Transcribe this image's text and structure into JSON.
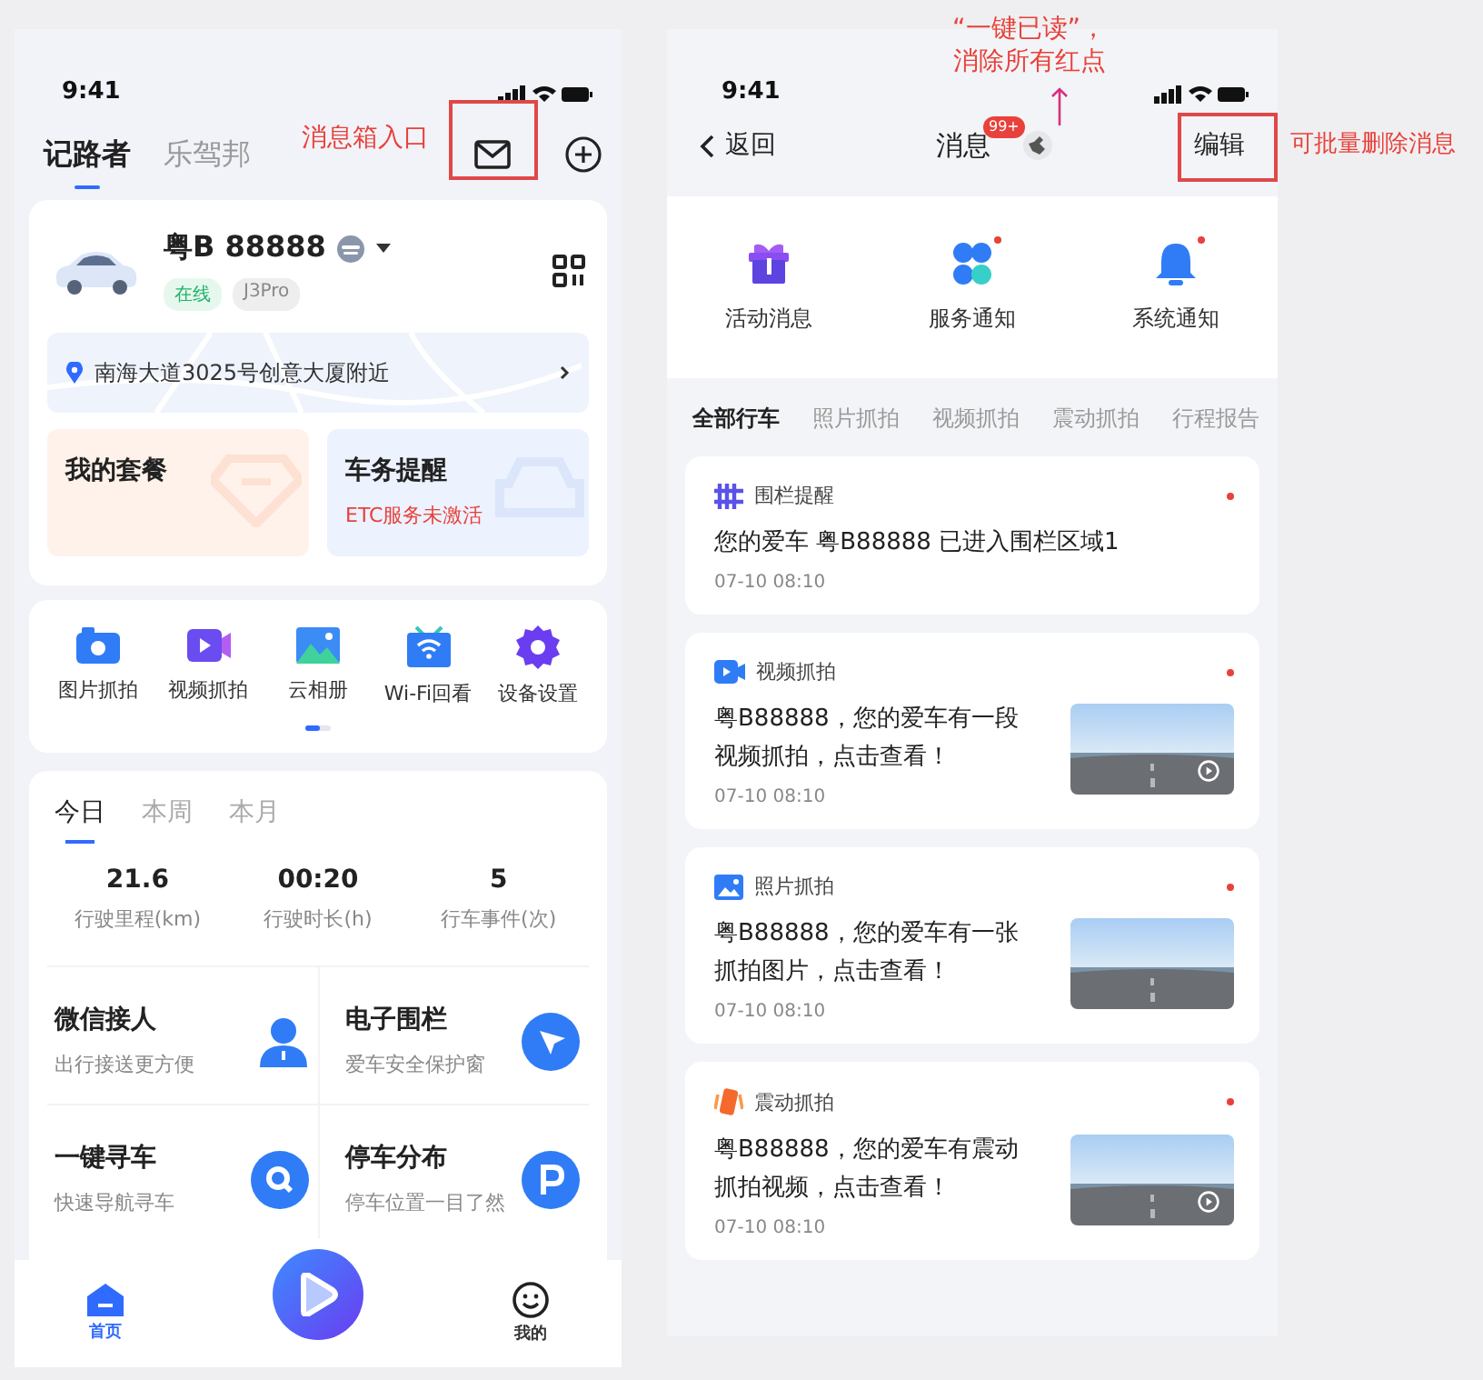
{
  "left_phone": {
    "status_time": "9:41",
    "header_tabs": [
      {
        "label": "记路者",
        "selected": true
      },
      {
        "label": "乐驾邦",
        "selected": false
      }
    ],
    "vehicle": {
      "plate": "粤B 88888",
      "tags": [
        {
          "label": "在线",
          "kind": "status"
        },
        {
          "label": "J3Pro",
          "kind": "model"
        }
      ],
      "location": "南海大道3025号创意大厦附近"
    },
    "cards": [
      {
        "kind": "plan",
        "title": "我的套餐"
      },
      {
        "kind": "reminder",
        "title": "车务提醒",
        "subtitle": "ETC服务未激活"
      }
    ],
    "shortcuts": [
      {
        "kind": "camera",
        "label": "图片抓拍"
      },
      {
        "kind": "video",
        "label": "视频抓拍"
      },
      {
        "kind": "album",
        "label": "云相册"
      },
      {
        "kind": "wifi",
        "label": "Wi-Fi回看"
      },
      {
        "kind": "settings",
        "label": "设备设置"
      }
    ],
    "stats_tabs": [
      {
        "label": "今日",
        "selected": true
      },
      {
        "label": "本周",
        "selected": false
      },
      {
        "label": "本月",
        "selected": false
      }
    ],
    "stats": [
      {
        "value": "21.6",
        "label": "行驶里程(km)"
      },
      {
        "value": "00:20",
        "label": "行驶时长(h)"
      },
      {
        "value": "5",
        "label": "行车事件(次)"
      }
    ],
    "services": [
      {
        "kind": "person",
        "title": "微信接人",
        "subtitle": "出行接送更方便"
      },
      {
        "kind": "navigate",
        "title": "电子围栏",
        "subtitle": "爱车安全保护窗"
      },
      {
        "kind": "search",
        "title": "一键寻车",
        "subtitle": "快速导航寻车"
      },
      {
        "kind": "parking",
        "title": "停车分布",
        "subtitle": "停车位置一目了然"
      }
    ],
    "bottom_nav": [
      {
        "kind": "home",
        "label": "首页",
        "selected": true
      },
      {
        "kind": "play"
      },
      {
        "kind": "profile",
        "label": "我的",
        "selected": false
      }
    ]
  },
  "right_phone": {
    "status_time": "9:41",
    "back": "返回",
    "title": "消息",
    "badge": "99+",
    "edit": "编辑",
    "categories": [
      {
        "kind": "gift",
        "label": "活动消息",
        "unread": false
      },
      {
        "kind": "service",
        "label": "服务通知",
        "unread": true
      },
      {
        "kind": "bell",
        "label": "系统通知",
        "unread": true
      }
    ],
    "filters": [
      {
        "label": "全部行车",
        "selected": true
      },
      {
        "label": "照片抓拍",
        "selected": false
      },
      {
        "label": "视频抓拍",
        "selected": false
      },
      {
        "label": "震动抓拍",
        "selected": false
      },
      {
        "label": "行程报告",
        "selected": false
      }
    ],
    "messages": [
      {
        "kind": "fence",
        "category": "围栏提醒",
        "body": "您的爱车 粤B88888 已进入围栏区域1",
        "time": "07-10 08:10",
        "unread": true
      },
      {
        "kind": "video",
        "category": "视频抓拍",
        "body": "粤B88888，您的爱车有一段视频抓拍，点击查看！",
        "time": "07-10 08:10",
        "unread": true,
        "thumbnail": {
          "kind": "video"
        }
      },
      {
        "category": "照片抓拍",
        "body": "粤B88888，您的爱车有一张抓拍图片，点击查看！",
        "time": "07-10 08:10",
        "unread": true
      },
      {
        "kind": "vibration",
        "category": "震动抓拍",
        "body": "粤B88888，您的爱车有震动抓拍视频，点击查看！",
        "time": "07-10 08:10",
        "unread": true,
        "thumbnail": {
          "kind": "video"
        }
      }
    ]
  },
  "annotations": {
    "inbox_entry": "消息箱入口",
    "mark_all_read": [
      "“一键已读”，",
      "消除所有红点"
    ],
    "batch_delete": "可批量删除消息"
  }
}
